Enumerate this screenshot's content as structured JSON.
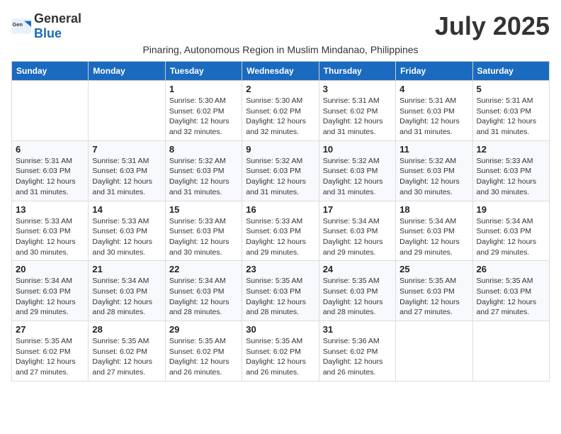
{
  "logo": {
    "text_general": "General",
    "text_blue": "Blue"
  },
  "month_title": "July 2025",
  "subtitle": "Pinaring, Autonomous Region in Muslim Mindanao, Philippines",
  "weekdays": [
    "Sunday",
    "Monday",
    "Tuesday",
    "Wednesday",
    "Thursday",
    "Friday",
    "Saturday"
  ],
  "weeks": [
    [
      {
        "day": "",
        "sunrise": "",
        "sunset": "",
        "daylight": ""
      },
      {
        "day": "",
        "sunrise": "",
        "sunset": "",
        "daylight": ""
      },
      {
        "day": "1",
        "sunrise": "Sunrise: 5:30 AM",
        "sunset": "Sunset: 6:02 PM",
        "daylight": "Daylight: 12 hours and 32 minutes."
      },
      {
        "day": "2",
        "sunrise": "Sunrise: 5:30 AM",
        "sunset": "Sunset: 6:02 PM",
        "daylight": "Daylight: 12 hours and 32 minutes."
      },
      {
        "day": "3",
        "sunrise": "Sunrise: 5:31 AM",
        "sunset": "Sunset: 6:02 PM",
        "daylight": "Daylight: 12 hours and 31 minutes."
      },
      {
        "day": "4",
        "sunrise": "Sunrise: 5:31 AM",
        "sunset": "Sunset: 6:03 PM",
        "daylight": "Daylight: 12 hours and 31 minutes."
      },
      {
        "day": "5",
        "sunrise": "Sunrise: 5:31 AM",
        "sunset": "Sunset: 6:03 PM",
        "daylight": "Daylight: 12 hours and 31 minutes."
      }
    ],
    [
      {
        "day": "6",
        "sunrise": "Sunrise: 5:31 AM",
        "sunset": "Sunset: 6:03 PM",
        "daylight": "Daylight: 12 hours and 31 minutes."
      },
      {
        "day": "7",
        "sunrise": "Sunrise: 5:31 AM",
        "sunset": "Sunset: 6:03 PM",
        "daylight": "Daylight: 12 hours and 31 minutes."
      },
      {
        "day": "8",
        "sunrise": "Sunrise: 5:32 AM",
        "sunset": "Sunset: 6:03 PM",
        "daylight": "Daylight: 12 hours and 31 minutes."
      },
      {
        "day": "9",
        "sunrise": "Sunrise: 5:32 AM",
        "sunset": "Sunset: 6:03 PM",
        "daylight": "Daylight: 12 hours and 31 minutes."
      },
      {
        "day": "10",
        "sunrise": "Sunrise: 5:32 AM",
        "sunset": "Sunset: 6:03 PM",
        "daylight": "Daylight: 12 hours and 31 minutes."
      },
      {
        "day": "11",
        "sunrise": "Sunrise: 5:32 AM",
        "sunset": "Sunset: 6:03 PM",
        "daylight": "Daylight: 12 hours and 30 minutes."
      },
      {
        "day": "12",
        "sunrise": "Sunrise: 5:33 AM",
        "sunset": "Sunset: 6:03 PM",
        "daylight": "Daylight: 12 hours and 30 minutes."
      }
    ],
    [
      {
        "day": "13",
        "sunrise": "Sunrise: 5:33 AM",
        "sunset": "Sunset: 6:03 PM",
        "daylight": "Daylight: 12 hours and 30 minutes."
      },
      {
        "day": "14",
        "sunrise": "Sunrise: 5:33 AM",
        "sunset": "Sunset: 6:03 PM",
        "daylight": "Daylight: 12 hours and 30 minutes."
      },
      {
        "day": "15",
        "sunrise": "Sunrise: 5:33 AM",
        "sunset": "Sunset: 6:03 PM",
        "daylight": "Daylight: 12 hours and 30 minutes."
      },
      {
        "day": "16",
        "sunrise": "Sunrise: 5:33 AM",
        "sunset": "Sunset: 6:03 PM",
        "daylight": "Daylight: 12 hours and 29 minutes."
      },
      {
        "day": "17",
        "sunrise": "Sunrise: 5:34 AM",
        "sunset": "Sunset: 6:03 PM",
        "daylight": "Daylight: 12 hours and 29 minutes."
      },
      {
        "day": "18",
        "sunrise": "Sunrise: 5:34 AM",
        "sunset": "Sunset: 6:03 PM",
        "daylight": "Daylight: 12 hours and 29 minutes."
      },
      {
        "day": "19",
        "sunrise": "Sunrise: 5:34 AM",
        "sunset": "Sunset: 6:03 PM",
        "daylight": "Daylight: 12 hours and 29 minutes."
      }
    ],
    [
      {
        "day": "20",
        "sunrise": "Sunrise: 5:34 AM",
        "sunset": "Sunset: 6:03 PM",
        "daylight": "Daylight: 12 hours and 29 minutes."
      },
      {
        "day": "21",
        "sunrise": "Sunrise: 5:34 AM",
        "sunset": "Sunset: 6:03 PM",
        "daylight": "Daylight: 12 hours and 28 minutes."
      },
      {
        "day": "22",
        "sunrise": "Sunrise: 5:34 AM",
        "sunset": "Sunset: 6:03 PM",
        "daylight": "Daylight: 12 hours and 28 minutes."
      },
      {
        "day": "23",
        "sunrise": "Sunrise: 5:35 AM",
        "sunset": "Sunset: 6:03 PM",
        "daylight": "Daylight: 12 hours and 28 minutes."
      },
      {
        "day": "24",
        "sunrise": "Sunrise: 5:35 AM",
        "sunset": "Sunset: 6:03 PM",
        "daylight": "Daylight: 12 hours and 28 minutes."
      },
      {
        "day": "25",
        "sunrise": "Sunrise: 5:35 AM",
        "sunset": "Sunset: 6:03 PM",
        "daylight": "Daylight: 12 hours and 27 minutes."
      },
      {
        "day": "26",
        "sunrise": "Sunrise: 5:35 AM",
        "sunset": "Sunset: 6:03 PM",
        "daylight": "Daylight: 12 hours and 27 minutes."
      }
    ],
    [
      {
        "day": "27",
        "sunrise": "Sunrise: 5:35 AM",
        "sunset": "Sunset: 6:02 PM",
        "daylight": "Daylight: 12 hours and 27 minutes."
      },
      {
        "day": "28",
        "sunrise": "Sunrise: 5:35 AM",
        "sunset": "Sunset: 6:02 PM",
        "daylight": "Daylight: 12 hours and 27 minutes."
      },
      {
        "day": "29",
        "sunrise": "Sunrise: 5:35 AM",
        "sunset": "Sunset: 6:02 PM",
        "daylight": "Daylight: 12 hours and 26 minutes."
      },
      {
        "day": "30",
        "sunrise": "Sunrise: 5:35 AM",
        "sunset": "Sunset: 6:02 PM",
        "daylight": "Daylight: 12 hours and 26 minutes."
      },
      {
        "day": "31",
        "sunrise": "Sunrise: 5:36 AM",
        "sunset": "Sunset: 6:02 PM",
        "daylight": "Daylight: 12 hours and 26 minutes."
      },
      {
        "day": "",
        "sunrise": "",
        "sunset": "",
        "daylight": ""
      },
      {
        "day": "",
        "sunrise": "",
        "sunset": "",
        "daylight": ""
      }
    ]
  ]
}
